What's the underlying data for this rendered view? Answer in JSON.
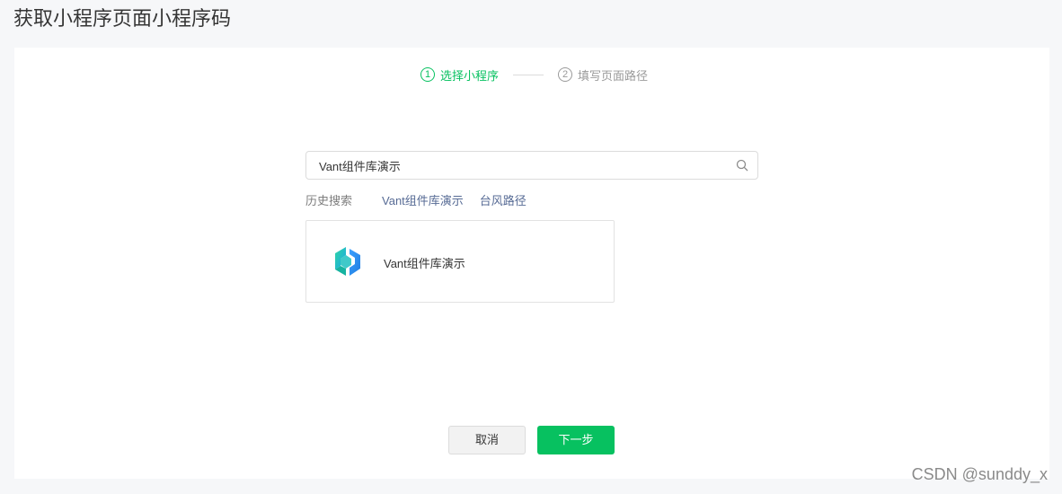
{
  "page": {
    "title": "获取小程序页面小程序码"
  },
  "steps": [
    {
      "number": "1",
      "label": "选择小程序",
      "state": "active"
    },
    {
      "number": "2",
      "label": "填写页面路径",
      "state": "inactive"
    }
  ],
  "search": {
    "value": "Vant组件库演示",
    "placeholder": "",
    "icon": "search-icon"
  },
  "history": {
    "label": "历史搜索",
    "items": [
      "Vant组件库演示",
      "台风路径"
    ]
  },
  "result": {
    "name": "Vant组件库演示",
    "icon": "vant-logo-icon"
  },
  "buttons": {
    "cancel": "取消",
    "next": "下一步"
  },
  "watermark": "CSDN @sunddy_x",
  "colors": {
    "accent": "#07c160",
    "link": "#576b95"
  }
}
